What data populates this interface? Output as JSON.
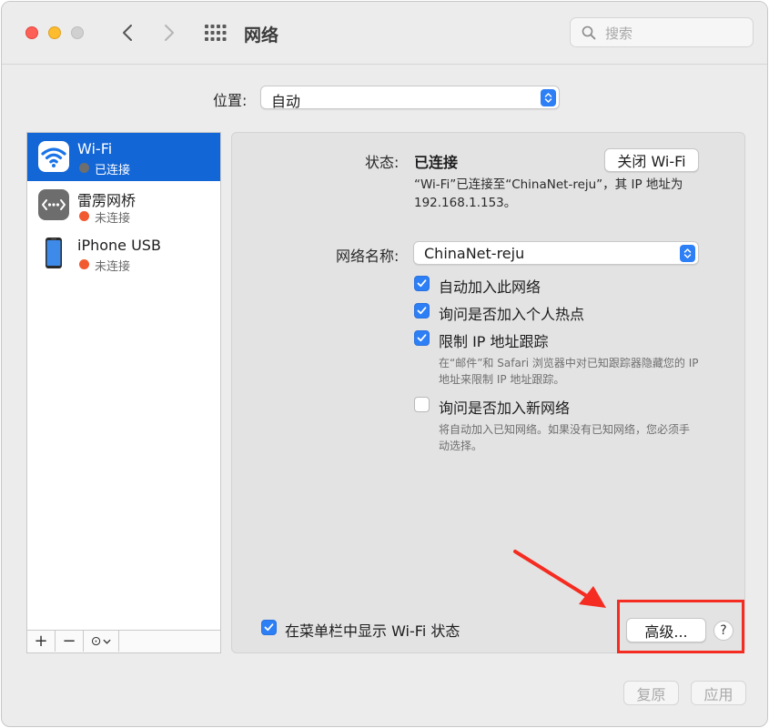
{
  "window": {
    "title": "网络",
    "search_placeholder": "搜索"
  },
  "location": {
    "label": "位置:",
    "value": "自动"
  },
  "services": [
    {
      "name": "Wi-Fi",
      "status": "已连接",
      "selected": true,
      "icon": "wifi-icon",
      "dot_color": "#6e6e6e"
    },
    {
      "name": "雷雳网桥",
      "status": "未连接",
      "selected": false,
      "icon": "thunderbolt-bridge-icon",
      "dot_color": "#f15a30"
    },
    {
      "name": "iPhone USB",
      "status": "未连接",
      "selected": false,
      "icon": "iphone-icon",
      "dot_color": "#f15a30"
    }
  ],
  "sidebar_footer": {
    "add": "+",
    "remove": "−",
    "more": "⊙"
  },
  "detail": {
    "status_label": "状态:",
    "status_value": "已连接",
    "turn_off_button": "关闭 Wi-Fi",
    "status_desc_line1": "“Wi-Fi”已连接至“ChinaNet-reju”，其 IP 地址为",
    "status_desc_line2": "192.168.1.153。",
    "network_name_label": "网络名称:",
    "network_name_value": "ChinaNet-reju",
    "options": [
      {
        "label": "自动加入此网络",
        "checked": true
      },
      {
        "label": "询问是否加入个人热点",
        "checked": true
      },
      {
        "label": "限制 IP 地址跟踪",
        "checked": true
      },
      {
        "label": "询问是否加入新网络",
        "checked": false
      }
    ],
    "limit_ip_note_line1": "在“邮件”和 Safari 浏览器中对已知跟踪器隐藏您的 IP",
    "limit_ip_note_line2": "地址来限制 IP 地址跟踪。",
    "ask_new_note_line1": "将自动加入已知网络。如果没有已知网络，您必须手",
    "ask_new_note_line2": "动选择。",
    "menubar_checkbox": {
      "label": "在菜单栏中显示 Wi-Fi 状态",
      "checked": true
    },
    "advanced_button": "高级...",
    "help_button": "?"
  },
  "bottom": {
    "revert_button": "复原",
    "apply_button": "应用"
  },
  "colors": {
    "accent": "#2d7ff6",
    "selection": "#1366d6",
    "annotation_red": "#f42c21"
  }
}
